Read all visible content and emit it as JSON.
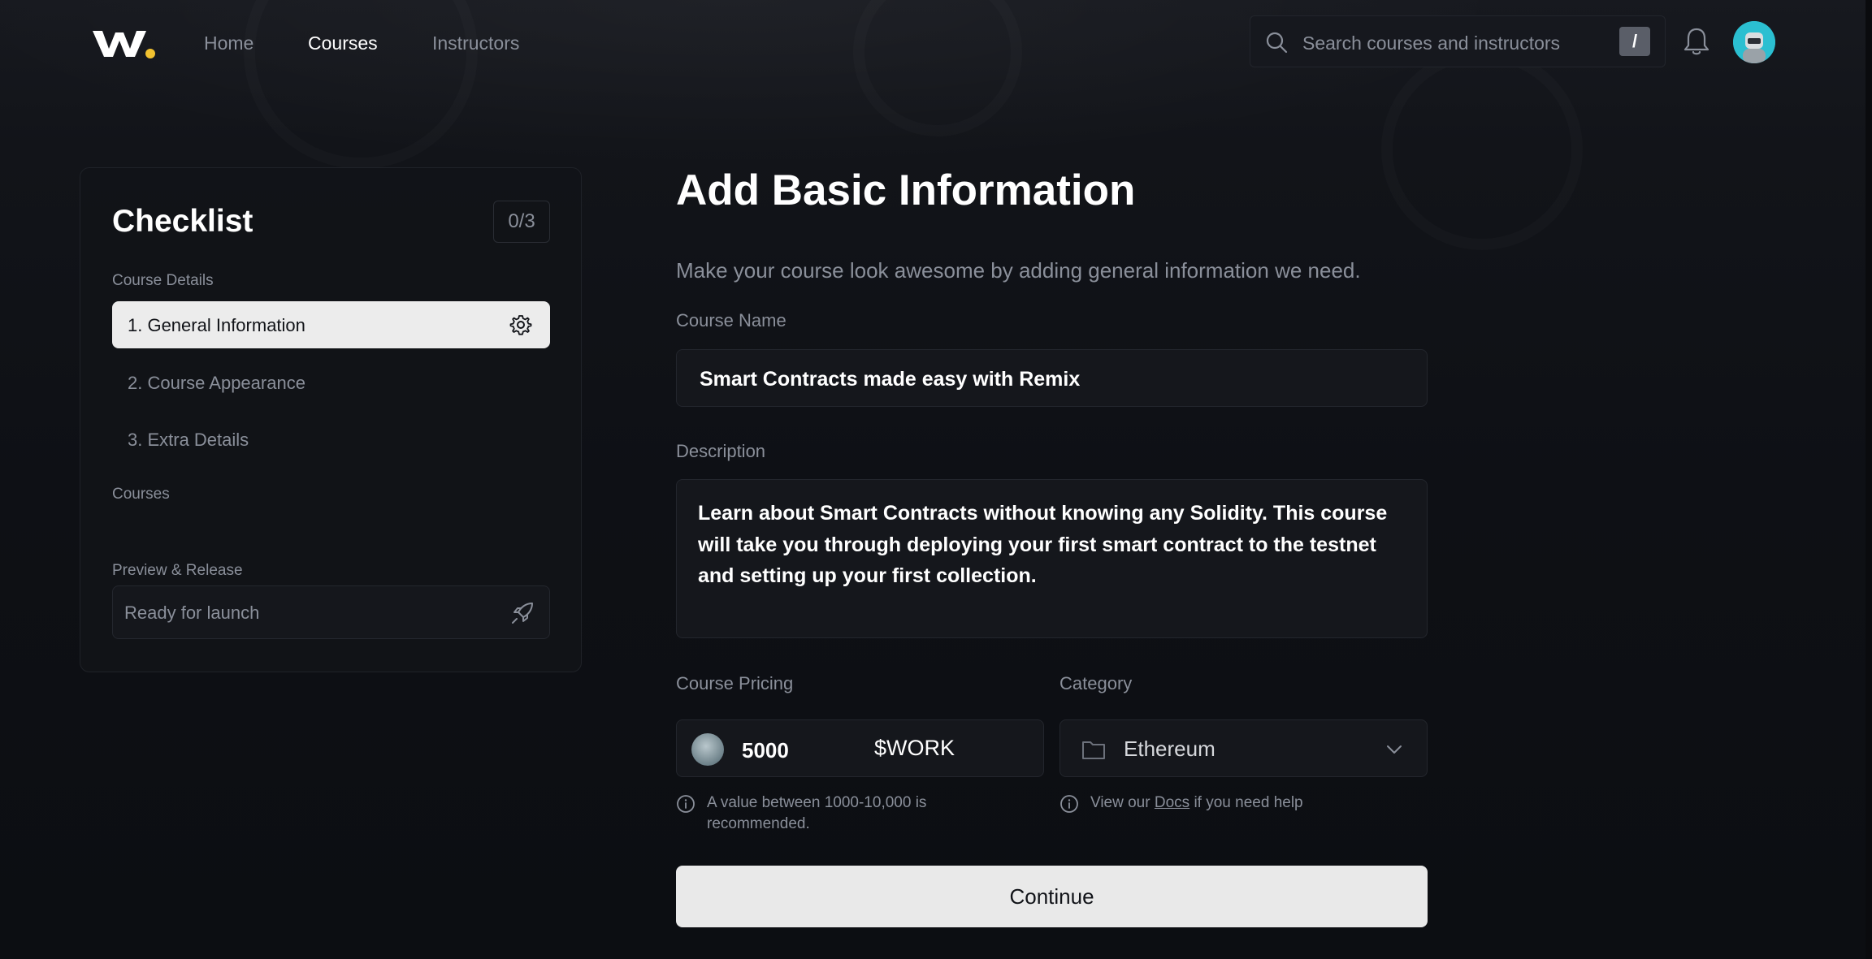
{
  "header": {
    "nav": [
      {
        "label": "Home",
        "active": false
      },
      {
        "label": "Courses",
        "active": true
      },
      {
        "label": "Instructors",
        "active": false
      }
    ],
    "search": {
      "placeholder": "Search courses and instructors",
      "shortcut": "/"
    },
    "icons": {
      "logo": "w-logo",
      "search": "search-icon",
      "bell": "bell-icon",
      "avatar": "user-avatar"
    }
  },
  "sidebar": {
    "title": "Checklist",
    "progress": "0/3",
    "sections": {
      "course_details": "Course Details",
      "courses": "Courses",
      "preview": "Preview & Release"
    },
    "items": [
      {
        "label": "1. General Information",
        "active": true
      },
      {
        "label": "2. Course Appearance",
        "active": false
      },
      {
        "label": "3. Extra Details",
        "active": false
      }
    ],
    "launch": {
      "label": "Ready for launch",
      "icon": "rocket-icon"
    }
  },
  "main": {
    "title": "Add Basic Information",
    "subtitle": "Make your course look awesome by adding general information we need.",
    "course_name": {
      "label": "Course Name",
      "value": "Smart Contracts made easy with Remix"
    },
    "description": {
      "label": "Description",
      "value": "Learn about Smart Contracts without knowing any Solidity. This course will take you through deploying your first smart contract to the testnet and setting up your first collection."
    },
    "pricing": {
      "label": "Course Pricing",
      "value": "5000",
      "unit": "$WORK",
      "hint": "A value between 1000-10,000 is recommended."
    },
    "category": {
      "label": "Category",
      "value": "Ethereum",
      "hint_before": "View our",
      "hint_link": "Docs",
      "hint_after": "if you need help"
    },
    "continue_label": "Continue"
  },
  "colors": {
    "background": "#101218",
    "card": "#111318",
    "field": "#15171c",
    "muted_text": "#8a8f9a",
    "active_item_bg": "#ececec",
    "button_bg": "#e9e9e9",
    "avatar": "#2bbfd1"
  }
}
